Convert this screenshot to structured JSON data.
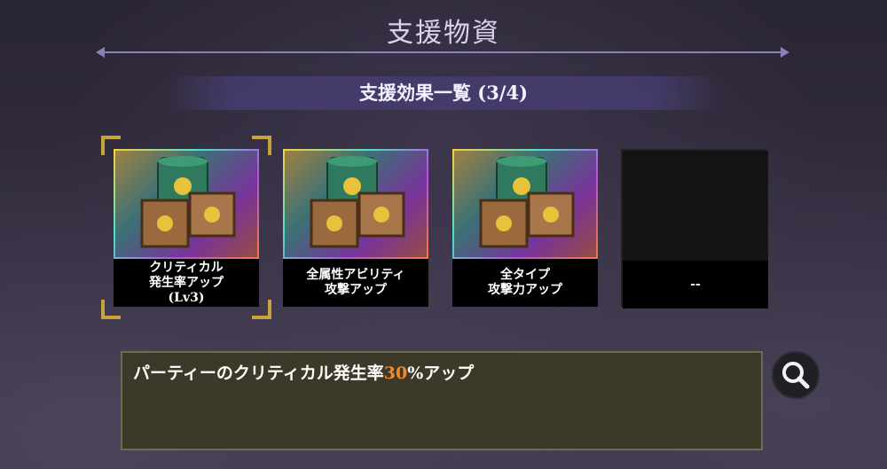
{
  "header": {
    "title": "支援物資"
  },
  "banner": {
    "text": "支援効果一覧 (3/4)"
  },
  "cards": [
    {
      "line1": "クリティカル",
      "line2": "発生率アップ",
      "line3": "(Lv3)",
      "selected": true
    },
    {
      "line1": "全属性アビリティ",
      "line2": "攻撃アップ",
      "line3": "",
      "selected": false
    },
    {
      "line1": "全タイプ",
      "line2": "攻撃力アップ",
      "line3": "",
      "selected": false
    },
    {
      "line1": "--",
      "line2": "",
      "line3": "",
      "selected": false,
      "empty": true
    }
  ],
  "description": {
    "prefix": "パーティーのクリティカル発生率",
    "value": "30",
    "suffix": "%アップ"
  },
  "colors": {
    "accent_frame": "#c8a23a",
    "highlight": "#f08a2a"
  },
  "icons": {
    "zoom": "magnifier-icon",
    "item": "supply-crates-barrel-icon"
  }
}
